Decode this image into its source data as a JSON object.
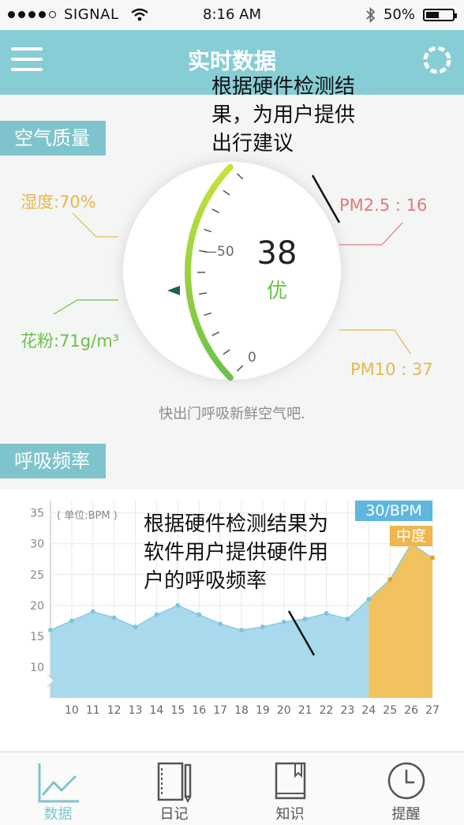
{
  "status_bar": {
    "carrier": "SIGNAL",
    "time": "8:16 AM",
    "battery": "50%",
    "battery_level": 0.5,
    "signal_bars": 4,
    "signal_total": 5
  },
  "navbar": {
    "title": "实时数据"
  },
  "annotation_top": {
    "lines": [
      "根据硬件检测结",
      "果，为用户提供",
      "出行建议"
    ]
  },
  "annotation_chart": {
    "lines": [
      "根据硬件检测结果为",
      "软件用户提供硬件用",
      "户的呼吸频率"
    ]
  },
  "air_quality": {
    "section_title": "空气质量",
    "value": "38",
    "grade": "优",
    "scale_labels": [
      "50",
      "0"
    ],
    "humidity": "湿度:70%",
    "pollen": "花粉:71g/m³",
    "pm25": "PM2.5 : 16",
    "pm10": "PM10 : 37",
    "tip": "快出门呼吸新鲜空气吧."
  },
  "breathing": {
    "section_title": "呼吸频率",
    "unit_label": "( 单位:BPM )",
    "current_badge": "30/BPM",
    "level_badge": "中度"
  },
  "chart_data": {
    "type": "area",
    "ylabel": "单位:BPM",
    "x": [
      9,
      10,
      11,
      12,
      13,
      14,
      15,
      16,
      17,
      18,
      19,
      20,
      21,
      22,
      23,
      24,
      25,
      26,
      27
    ],
    "x_ticks": [
      10,
      11,
      12,
      13,
      14,
      15,
      16,
      17,
      18,
      19,
      20,
      21,
      22,
      23,
      24,
      25,
      26,
      27
    ],
    "y_ticks": [
      10,
      15,
      20,
      25,
      30,
      35
    ],
    "ylim": [
      5,
      37
    ],
    "series": [
      {
        "values": [
          16,
          17.5,
          19,
          18,
          16.5,
          18.5,
          20,
          18.5,
          17,
          16,
          16.5,
          17.3,
          17.8,
          18.7,
          17.8,
          21,
          24.2,
          30,
          27.7
        ]
      }
    ],
    "normal_color": "#a9d9ec",
    "highlight_color": "#f2c25e",
    "highlight_from_x": 24,
    "grid": true
  },
  "tab_bar": {
    "tabs": [
      {
        "label": "数据",
        "icon": "chart-line-icon",
        "active": true
      },
      {
        "label": "日记",
        "icon": "diary-icon",
        "active": false
      },
      {
        "label": "知识",
        "icon": "book-icon",
        "active": false
      },
      {
        "label": "提醒",
        "icon": "clock-icon",
        "active": false
      }
    ]
  },
  "colors": {
    "accent": "#87cdd6",
    "section_tab": "#7fc4cc",
    "good": "#6cc04a",
    "humidity": "#e6b84e",
    "pollen": "#6cc04a",
    "pm25": "#e07a7a",
    "pm10": "#e6b84e"
  }
}
